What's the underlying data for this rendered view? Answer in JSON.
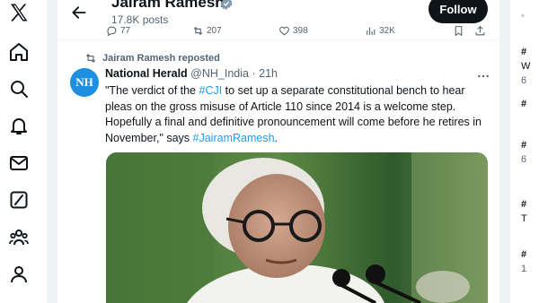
{
  "profile": {
    "name": "Jairam Ramesh",
    "posts_count": "17.8K posts",
    "follow_label": "Follow"
  },
  "post_actions": {
    "replies": "77",
    "reposts": "207",
    "likes": "398",
    "views": "32K"
  },
  "repost": {
    "label": "Jairam Ramesh reposted"
  },
  "tweet": {
    "author_name": "National Herald",
    "author_handle": "@NH_India",
    "separator": "·",
    "time": "21h",
    "avatar_text": "NH",
    "text_part1": "\"The verdict of the ",
    "hashtag1": "#CJI",
    "text_part2": " to set up a separate constitutional bench to hear pleas on the gross misuse of Article 110 since 2014 is a welcome step. Hopefully a final and definitive pronouncement will come before he retires in November,\" says ",
    "hashtag2": "#JairamRamesh",
    "text_part3": "."
  },
  "right_column": {
    "items": [
      "#",
      "W",
      "6",
      "#",
      "#",
      "6",
      "#",
      "T",
      "#",
      "1"
    ]
  },
  "icons": {
    "nav": [
      "x-logo-icon",
      "home-icon",
      "search-icon",
      "notifications-icon",
      "messages-icon",
      "grok-icon",
      "communities-icon",
      "profile-icon"
    ]
  },
  "colors": {
    "accent": "#1d9bf0",
    "text": "#0f1419",
    "muted": "#536471",
    "divider": "#eff3f4"
  }
}
